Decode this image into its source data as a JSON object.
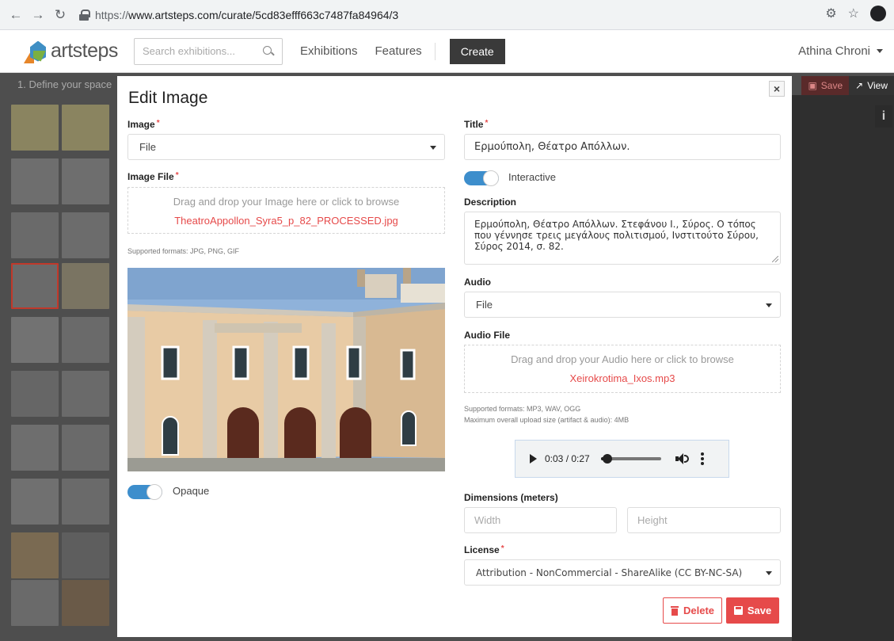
{
  "browser": {
    "url_scheme": "https://",
    "url_rest": "www.artsteps.com/curate/5cd83efff663c7487fa84964/3"
  },
  "header": {
    "logo_text": "artsteps",
    "search_placeholder": "Search exhibitions...",
    "nav": [
      "Exhibitions",
      "Features"
    ],
    "create_label": "Create",
    "user_name": "Athina Chroni"
  },
  "editor": {
    "step_label": "1. Define your space",
    "save_label": "Save",
    "view_label": "View",
    "info_label": "i"
  },
  "modal": {
    "title": "Edit Image",
    "close_label": "×",
    "image_label": "Image",
    "image_select": "File",
    "image_file_label": "Image File",
    "image_drop_hint": "Drag and drop your Image here or click to browse",
    "image_file_name": "TheatroAppollon_Syra5_p_82_PROCESSED.jpg",
    "image_formats": "Supported formats: JPG, PNG, GIF",
    "opaque_label": "Opaque",
    "title_label": "Title",
    "title_value": "Ερμούπολη, Θέατρο Απόλλων.",
    "interactive_label": "Interactive",
    "description_label": "Description",
    "description_value": "Ερμούπολη, Θέατρο Απόλλων. Στεφάνου Ι., Σύρος. Ο τόπος που γέννησε τρεις μεγάλους πολιτισμού, Ινστιτούτο Σύρου, Σύρος 2014, σ. 82.",
    "audio_label": "Audio",
    "audio_select": "File",
    "audio_file_label": "Audio File",
    "audio_drop_hint": "Drag and drop your Audio here or click to browse",
    "audio_file_name": "Xeirokrotima_Ixos.mp3",
    "audio_formats": "Supported formats: MP3, WAV, OGG",
    "audio_max_size": "Maximum overall upload size (artifact & audio): 4MB",
    "player_time": "0:03 / 0:27",
    "player_progress": 0.11,
    "dimensions_label": "Dimensions (meters)",
    "width_placeholder": "Width",
    "height_placeholder": "Height",
    "license_label": "License",
    "license_value": "Attribution - NonCommercial - ShareAlike (CC BY-NC-SA)",
    "delete_label": "Delete",
    "save_label": "Save"
  },
  "colors": {
    "accent": "#e64a4a",
    "toggle": "#3d8ecc"
  }
}
